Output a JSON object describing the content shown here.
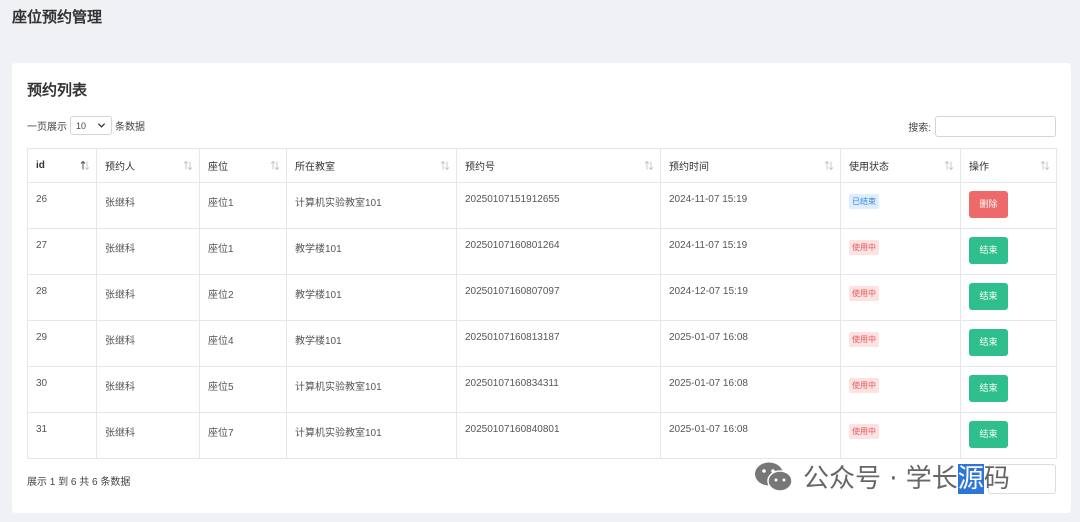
{
  "page": {
    "title": "座位预约管理"
  },
  "card": {
    "title": "预约列表"
  },
  "length_menu": {
    "prefix": "一页展示",
    "value": "10",
    "suffix": "条数据"
  },
  "search": {
    "label": "搜索:",
    "value": ""
  },
  "table": {
    "columns": [
      "id",
      "预约人",
      "座位",
      "所在教室",
      "预约号",
      "预约时间",
      "使用状态",
      "操作"
    ],
    "rows": [
      {
        "id": "26",
        "person": "张继科",
        "seat": "座位1",
        "room": "计算机实验教室101",
        "number": "20250107151912655",
        "time": "2024-11-07 15:19",
        "status": "已结束",
        "status_kind": "ended",
        "action": "删除",
        "action_kind": "delete"
      },
      {
        "id": "27",
        "person": "张继科",
        "seat": "座位1",
        "room": "教学楼101",
        "number": "20250107160801264",
        "time": "2024-11-07 15:19",
        "status": "使用中",
        "status_kind": "inuse",
        "action": "结束",
        "action_kind": "end"
      },
      {
        "id": "28",
        "person": "张继科",
        "seat": "座位2",
        "room": "教学楼101",
        "number": "20250107160807097",
        "time": "2024-12-07 15:19",
        "status": "使用中",
        "status_kind": "inuse",
        "action": "结束",
        "action_kind": "end"
      },
      {
        "id": "29",
        "person": "张继科",
        "seat": "座位4",
        "room": "教学楼101",
        "number": "20250107160813187",
        "time": "2025-01-07 16:08",
        "status": "使用中",
        "status_kind": "inuse",
        "action": "结束",
        "action_kind": "end"
      },
      {
        "id": "30",
        "person": "张继科",
        "seat": "座位5",
        "room": "计算机实验教室101",
        "number": "20250107160834311",
        "time": "2025-01-07 16:08",
        "status": "使用中",
        "status_kind": "inuse",
        "action": "结束",
        "action_kind": "end"
      },
      {
        "id": "31",
        "person": "张继科",
        "seat": "座位7",
        "room": "计算机实验教室101",
        "number": "20250107160840801",
        "time": "2025-01-07 16:08",
        "status": "使用中",
        "status_kind": "inuse",
        "action": "结束",
        "action_kind": "end"
      }
    ]
  },
  "footer": {
    "info": "展示 1 到 6 共 6 条数据"
  },
  "watermark": {
    "icon": "wechat-icon",
    "text_a": "公众号 · 学长",
    "text_hl": "源",
    "text_b": "码"
  },
  "colors": {
    "delete": "#ee6a6a",
    "end": "#2fbf8d",
    "badge_ended": "#3a86d4",
    "badge_inuse": "#e35a5a"
  }
}
